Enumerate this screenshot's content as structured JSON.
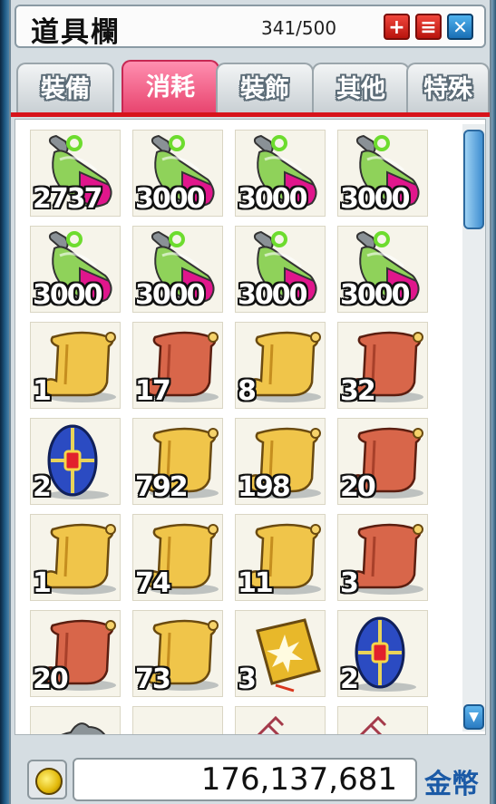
{
  "window": {
    "title": "道具欄",
    "capacity": "341/500",
    "buttons": {
      "add": "+",
      "list": "≡",
      "expand": "✕"
    }
  },
  "tabs": [
    {
      "label": "裝備",
      "active": false
    },
    {
      "label": "消耗",
      "active": true
    },
    {
      "label": "裝飾",
      "active": false
    },
    {
      "label": "其他",
      "active": false
    },
    {
      "label": "特殊",
      "active": false
    }
  ],
  "items": [
    {
      "icon": "potion-icon",
      "qty": "2737"
    },
    {
      "icon": "potion-icon",
      "qty": "3000"
    },
    {
      "icon": "potion-icon",
      "qty": "3000"
    },
    {
      "icon": "potion-icon",
      "qty": "3000"
    },
    {
      "icon": "potion-icon",
      "qty": "3000"
    },
    {
      "icon": "potion-icon",
      "qty": "3000"
    },
    {
      "icon": "potion-icon",
      "qty": "3000"
    },
    {
      "icon": "potion-icon",
      "qty": "3000"
    },
    {
      "icon": "scroll-yellow-icon",
      "qty": "1"
    },
    {
      "icon": "scroll-red-icon",
      "qty": "17"
    },
    {
      "icon": "scroll-yellow-icon",
      "qty": "8"
    },
    {
      "icon": "scroll-red-icon",
      "qty": "32"
    },
    {
      "icon": "shield-gem-icon",
      "qty": "2"
    },
    {
      "icon": "scroll-yellow-icon",
      "qty": "792"
    },
    {
      "icon": "scroll-yellow-icon",
      "qty": "198"
    },
    {
      "icon": "scroll-red-icon",
      "qty": "20"
    },
    {
      "icon": "scroll-yellow-icon",
      "qty": "1"
    },
    {
      "icon": "scroll-yellow-icon",
      "qty": "74"
    },
    {
      "icon": "scroll-yellow-icon",
      "qty": "11"
    },
    {
      "icon": "scroll-red-icon",
      "qty": "3"
    },
    {
      "icon": "scroll-red-icon",
      "qty": "20"
    },
    {
      "icon": "scroll-yellow-icon",
      "qty": "73"
    },
    {
      "icon": "glowing-book-icon",
      "qty": "3"
    },
    {
      "icon": "shield-gem-icon",
      "qty": "2"
    },
    {
      "icon": "gray-creature-icon",
      "qty": ""
    },
    {
      "icon": "teal-orb-icon",
      "qty": ""
    },
    {
      "icon": "pink-item-icon",
      "qty": ""
    },
    {
      "icon": "pink-item-icon",
      "qty": ""
    }
  ],
  "footer": {
    "money": "176,137,681",
    "currency": "金幣"
  },
  "colors": {
    "active_tab": "#e8456f",
    "tab_underline": "#d7131b",
    "currency_text": "#1b5aa6"
  }
}
